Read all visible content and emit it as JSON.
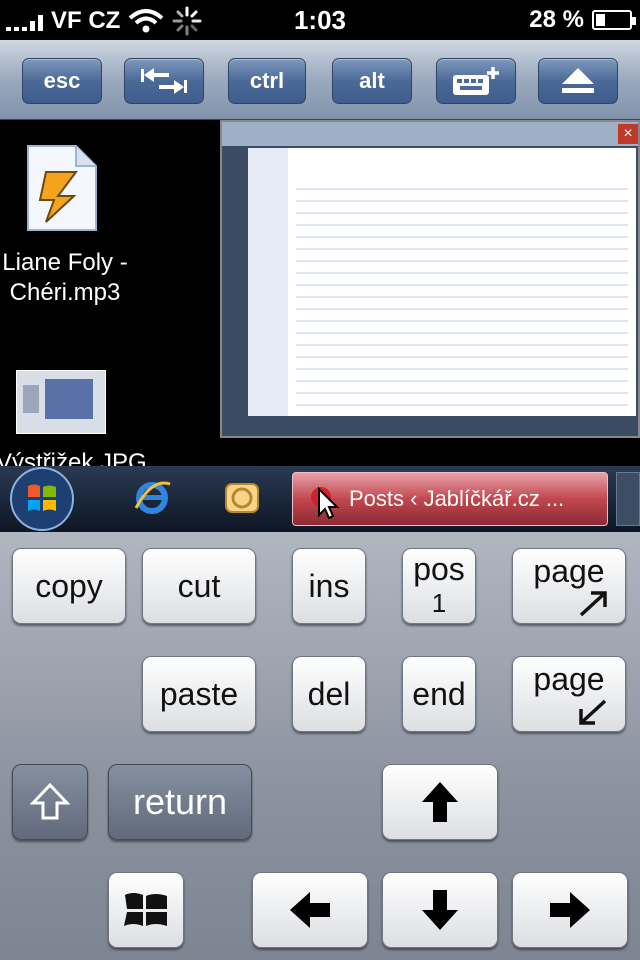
{
  "status_bar": {
    "carrier": "VF CZ",
    "time": "1:03",
    "battery_percent": "28 %",
    "battery_level": 0.28
  },
  "toolbar": {
    "esc_label": "esc",
    "ctrl_label": "ctrl",
    "alt_label": "alt"
  },
  "desktop": {
    "icons": [
      {
        "label": "Liane Foly - Chéri.mp3"
      },
      {
        "label": "Výstřižek.JPG"
      }
    ],
    "taskbar": {
      "active_window_title": "Posts ‹ Jablíčkář.cz ..."
    }
  },
  "keys": {
    "copy": "copy",
    "cut": "cut",
    "ins": "ins",
    "pos1_top": "pos",
    "pos1_bottom": "1",
    "page_up": "page",
    "paste": "paste",
    "del": "del",
    "end": "end",
    "page_down": "page",
    "return": "return"
  },
  "colors": {
    "toolbar_button": "#4c6a98",
    "taskbar_active": "#c2474f",
    "key_face": "#ffffff"
  }
}
